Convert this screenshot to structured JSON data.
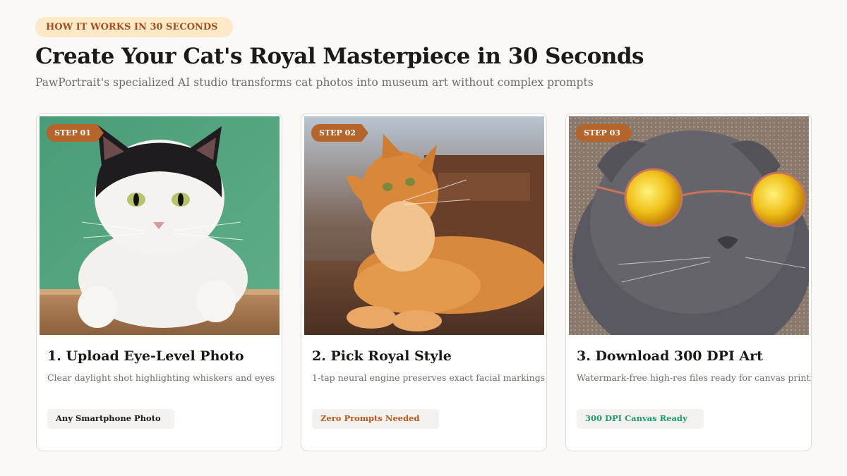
{
  "header": {
    "eyebrow": "HOW IT WORKS IN 30 SECONDS",
    "title": "Create Your Cat's Royal Masterpiece in 30 Seconds",
    "subtitle": "PawPortrait's specialized AI studio transforms cat photos into museum art without complex prompts"
  },
  "colors": {
    "accent": "#b5652c",
    "eyebrow_bg": "#fde8c8",
    "eyebrow_text": "#a0521c",
    "pill_dark": "#1c1a17",
    "pill_orange": "#c0561b",
    "pill_green": "#1a9a6e"
  },
  "steps": [
    {
      "tag": "STEP 01",
      "title": "1. Upload Eye-Level Photo",
      "description": "Clear daylight shot highlighting whiskers and eyes",
      "pill": "Any Smartphone Photo",
      "photo": "black-and-white-cat-on-green-background"
    },
    {
      "tag": "STEP 02",
      "title": "2. Pick Royal Style",
      "description": "1-tap neural engine preserves exact facial markings",
      "pill": "Zero Prompts Needed",
      "photo": "orange-long-haired-cat-lying-on-floor"
    },
    {
      "tag": "STEP 03",
      "title": "3. Download 300 DPI Art",
      "description": "Watermark-free high-res files ready for canvas printing",
      "pill": "300 DPI Canvas Ready",
      "photo": "grey-cat-wearing-yellow-sunglasses"
    }
  ]
}
